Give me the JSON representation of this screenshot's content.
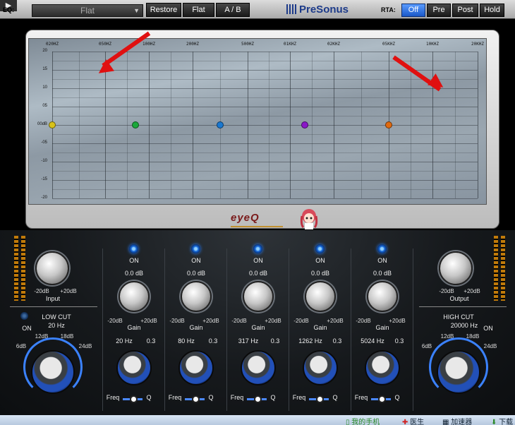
{
  "topbar": {
    "corner_glyph": "▶",
    "eq_label": "EQ:",
    "preset_value": "Flat",
    "restore_label": "Restore",
    "flat_label": "Flat",
    "ab_label": "A / B",
    "brand": "PreSonus",
    "rta_label": "RTA:",
    "rta_buttons": [
      "Off",
      "Pre",
      "Post",
      "Hold"
    ],
    "rta_active": "Off"
  },
  "graph": {
    "freq_labels": [
      "020HZ",
      "050HZ",
      "100HZ",
      "200HZ",
      "500HZ",
      "01KHZ",
      "02KHZ",
      "05KHZ",
      "10KHZ",
      "20KHZ"
    ],
    "db_labels": [
      "20",
      "15",
      "10",
      "05",
      "00dB",
      "-05",
      "-10",
      "-15",
      "-20"
    ],
    "band_colors": [
      "#d8c21a",
      "#1aa83a",
      "#1a78d0",
      "#8a18c8",
      "#e06a10"
    ],
    "logo": "eyeQ"
  },
  "input": {
    "range_min": "-20dB",
    "range_max": "+20dB",
    "label": "Input",
    "lowcut_title": "LOW CUT",
    "lowcut_freq": "20 Hz",
    "lowcut_on": "ON",
    "slopes": [
      "6dB",
      "12dB",
      "18dB",
      "24dB"
    ]
  },
  "output": {
    "range_min": "-20dB",
    "range_max": "+20dB",
    "label": "Output",
    "highcut_title": "HIGH CUT",
    "highcut_freq": "20000 Hz",
    "highcut_on": "ON",
    "slopes": [
      "6dB",
      "12dB",
      "18dB",
      "24dB"
    ]
  },
  "bands": [
    {
      "on": "ON",
      "gain": "0.0 dB",
      "min": "-20dB",
      "max": "+20dB",
      "gain_label": "Gain",
      "freq": "20 Hz",
      "q": "0.3",
      "freq_label": "Freq",
      "q_label": "Q"
    },
    {
      "on": "ON",
      "gain": "0.0 dB",
      "min": "-20dB",
      "max": "+20dB",
      "gain_label": "Gain",
      "freq": "80 Hz",
      "q": "0.3",
      "freq_label": "Freq",
      "q_label": "Q"
    },
    {
      "on": "ON",
      "gain": "0.0 dB",
      "min": "-20dB",
      "max": "+20dB",
      "gain_label": "Gain",
      "freq": "317 Hz",
      "q": "0.3",
      "freq_label": "Freq",
      "q_label": "Q"
    },
    {
      "on": "ON",
      "gain": "0.0 dB",
      "min": "-20dB",
      "max": "+20dB",
      "gain_label": "Gain",
      "freq": "1262 Hz",
      "q": "0.3",
      "freq_label": "Freq",
      "q_label": "Q"
    },
    {
      "on": "ON",
      "gain": "0.0 dB",
      "min": "-20dB",
      "max": "+20dB",
      "gain_label": "Gain",
      "freq": "5024 Hz",
      "q": "0.3",
      "freq_label": "Freq",
      "q_label": "Q"
    }
  ],
  "taskbar": {
    "items": [
      "我的手机",
      "医生",
      "加速器",
      "下载"
    ]
  }
}
